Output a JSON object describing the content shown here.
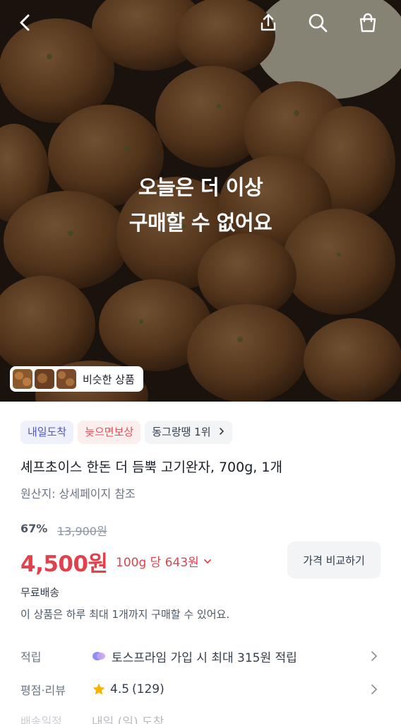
{
  "header": {
    "back_icon": "chevron-left-icon",
    "share_icon": "share-icon",
    "search_icon": "search-icon",
    "cart_icon": "shopping-bag-icon"
  },
  "hero": {
    "soldout_line1": "오늘은 더 이상",
    "soldout_line2": "구매할 수 없어요",
    "similar_label": "비슷한 상품"
  },
  "badges": [
    "내일도착",
    "늦으면보상",
    "동그랑땡 1위"
  ],
  "product": {
    "title": "셰프초이스 한돈 더 듬뿍 고기완자, 700g, 1개",
    "origin": "원산지: 상세페이지 참조",
    "discount": "67%",
    "original_price": "13,900원",
    "price": "4,500원",
    "unit_price": "100g 당 643원",
    "compare_button": "가격 비교하기",
    "shipping": "무료배송",
    "limit_notice": "이 상품은 하루 최대 1개까지 구매할 수 있어요."
  },
  "info_rows": [
    {
      "key": "적립",
      "value": "토스프라임 가입 시 최대 315원 적립"
    },
    {
      "key": "평점·리뷰",
      "rating": "4.5",
      "count": "(129)"
    },
    {
      "key": "배송일정",
      "value": "내일 (일) 도착"
    }
  ],
  "colors": {
    "accent_red": "#e0424d",
    "badge_blue": "#4f57c9",
    "badge_pink": "#e0505a",
    "star": "#f5b400"
  }
}
